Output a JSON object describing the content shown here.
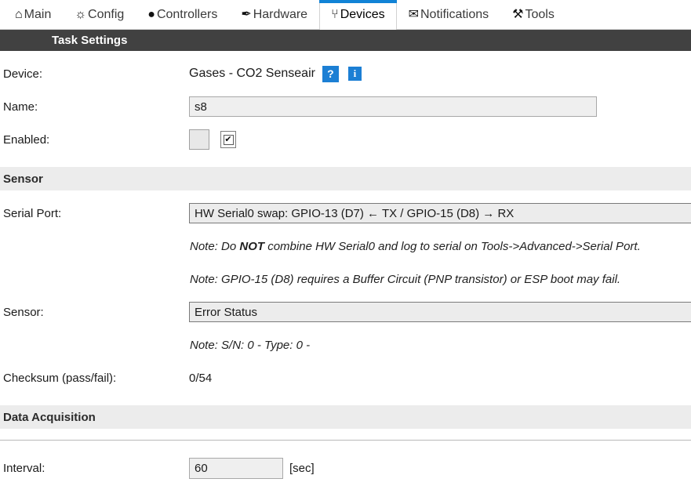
{
  "nav": {
    "items": [
      {
        "label": "Main",
        "icon": "home-icon",
        "glyph": "⌂",
        "active": false
      },
      {
        "label": "Config",
        "icon": "gear-icon",
        "glyph": "☼",
        "active": false
      },
      {
        "label": "Controllers",
        "icon": "chat-bubble-icon",
        "glyph": "●",
        "active": false
      },
      {
        "label": "Hardware",
        "icon": "pin-icon",
        "glyph": "✒",
        "active": false
      },
      {
        "label": "Devices",
        "icon": "plug-icon",
        "glyph": "⑂",
        "active": true
      },
      {
        "label": "Notifications",
        "icon": "envelope-icon",
        "glyph": "✉",
        "active": false
      },
      {
        "label": "Tools",
        "icon": "wrench-icon",
        "glyph": "⚒",
        "active": false
      }
    ]
  },
  "header": {
    "title": "Task Settings"
  },
  "form": {
    "device": {
      "label": "Device:",
      "value": "Gases - CO2 Senseair",
      "help_badge": "?",
      "info_badge": "i"
    },
    "name": {
      "label": "Name:",
      "value": "s8",
      "placeholder": ""
    },
    "enabled": {
      "label": "Enabled:",
      "checked_glyph": "✔"
    }
  },
  "sensor_section": {
    "title": "Sensor",
    "serial_port": {
      "label": "Serial Port:",
      "value": "HW Serial0 swap: GPIO-13 (D7) ← TX / GPIO-15 (D8) → RX"
    },
    "note_1_prefix": "Note: Do ",
    "note_1_bold": "NOT",
    "note_1_suffix": " combine HW Serial0 and log to serial on Tools->Advanced->Serial Port.",
    "note_2": "Note: GPIO-15 (D8) requires a Buffer Circuit (PNP transistor) or ESP boot may fail.",
    "sensor": {
      "label": "Sensor:",
      "value": "Error Status"
    },
    "note_3": "Note: S/N: 0 - Type: 0 -",
    "checksum": {
      "label": "Checksum (pass/fail):",
      "value": "0/54"
    }
  },
  "data_acquisition_section": {
    "title": "Data Acquisition",
    "interval": {
      "label": "Interval:",
      "value": "60",
      "unit": "[sec]"
    }
  },
  "colors": {
    "accent_blue": "#1183d6",
    "badge_blue": "#1c7fd4",
    "header_bar": "#414141",
    "section_band": "#ececec"
  }
}
